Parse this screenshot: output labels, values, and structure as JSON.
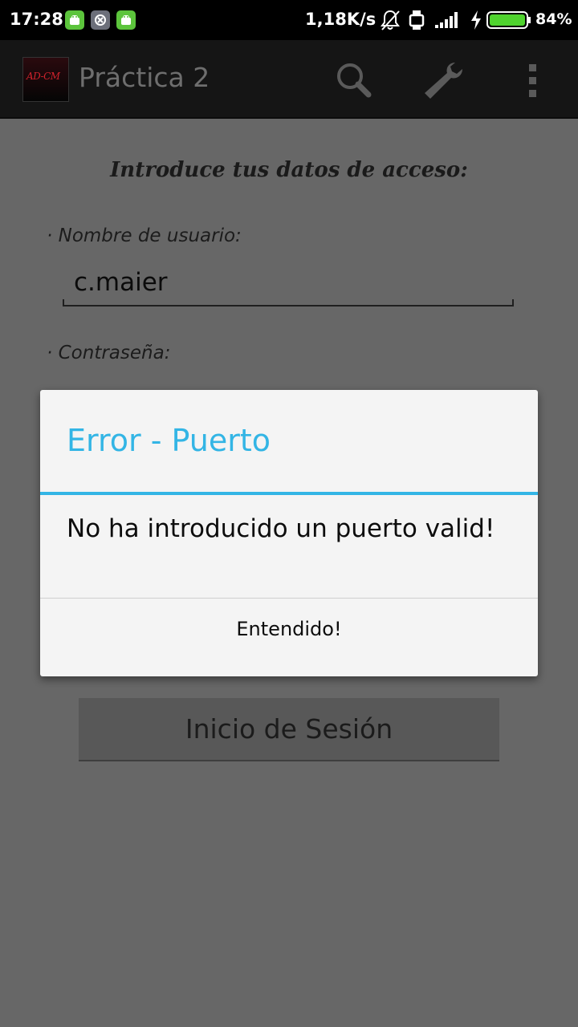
{
  "status_bar": {
    "time": "17:28",
    "network_speed": "1,18K/s",
    "battery_percent": "84%",
    "battery_level": 0.84,
    "icons": [
      "android-notification-icon",
      "android-notification-icon",
      "android-notification-icon",
      "notifications-muted-icon",
      "watch-icon",
      "signal-icon",
      "charging-icon",
      "battery-icon"
    ]
  },
  "action_bar": {
    "title": "Práctica 2",
    "logo_text": "AD-CM",
    "actions": [
      "search-icon",
      "wrench-icon",
      "overflow-menu-icon"
    ]
  },
  "form": {
    "heading": "Introduce tus datos de acceso:",
    "username_label": "· Nombre de usuario:",
    "username_value": "c.maier",
    "password_label": "· Contraseña:",
    "login_button": "Inicio de Sesión"
  },
  "dialog": {
    "title": "Error - Puerto",
    "message": "No ha introducido un puerto valid!",
    "button": "Entendido!"
  },
  "colors": {
    "accent": "#33b5e5",
    "scrim_background": "#676767",
    "action_bar": "#151515",
    "dialog_background": "#f4f4f4"
  }
}
